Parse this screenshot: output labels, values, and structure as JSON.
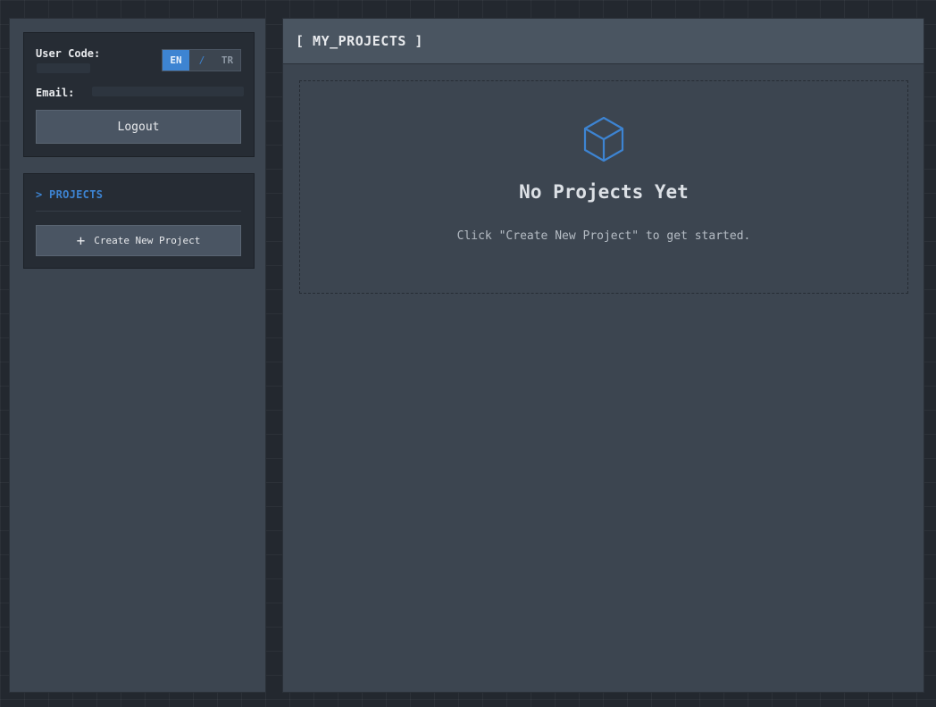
{
  "user_panel": {
    "user_code_label": "User Code:",
    "email_label": "Email:",
    "lang_en": "EN",
    "lang_separator": "/",
    "lang_tr": "TR",
    "logout_label": "Logout"
  },
  "nav": {
    "projects_label": "> PROJECTS",
    "create_icon": "+",
    "create_label": "Create New Project"
  },
  "main": {
    "title": "[ MY_PROJECTS ]",
    "empty_icon": "cube-icon",
    "empty_title": "No Projects Yet",
    "empty_subtitle": "Click \"Create New Project\" to get started."
  },
  "colors": {
    "accent": "#3d84d2",
    "panel": "#3c4550",
    "card": "#262c34",
    "background": "#23282f"
  }
}
